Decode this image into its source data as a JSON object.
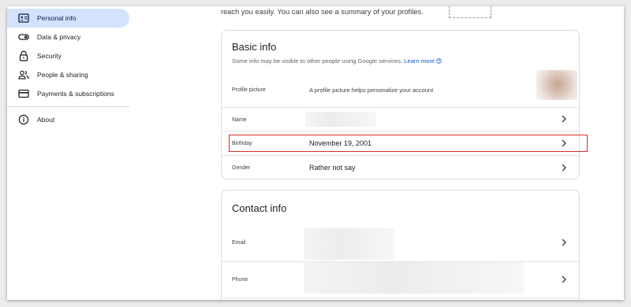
{
  "sidebar": {
    "items": [
      {
        "label": "Personal info",
        "icon": "id-card-icon",
        "active": true
      },
      {
        "label": "Data & privacy",
        "icon": "toggle-icon",
        "active": false
      },
      {
        "label": "Security",
        "icon": "lock-icon",
        "active": false
      },
      {
        "label": "People & sharing",
        "icon": "people-icon",
        "active": false
      },
      {
        "label": "Payments & subscriptions",
        "icon": "credit-card-icon",
        "active": false
      },
      {
        "label": "About",
        "icon": "info-icon",
        "active": false
      }
    ]
  },
  "main": {
    "intro_text": "reach you easily. You can also see a summary of your profiles."
  },
  "basic_info": {
    "title": "Basic info",
    "subtitle": "Some info may be visible to other people using Google services.",
    "learn_more": "Learn more",
    "rows": {
      "profile_picture": {
        "label": "Profile picture",
        "value": "A profile picture helps personalize your account"
      },
      "name": {
        "label": "Name",
        "value": ""
      },
      "birthday": {
        "label": "Birthday",
        "value": "November 19, 2001"
      },
      "gender": {
        "label": "Gender",
        "value": "Rather not say"
      }
    }
  },
  "contact_info": {
    "title": "Contact info",
    "rows": {
      "email": {
        "label": "Email",
        "value": ""
      },
      "phone": {
        "label": "Phone",
        "value": ""
      }
    }
  },
  "colors": {
    "active_nav_bg": "#d3e3fd",
    "link": "#0b57d0",
    "highlight_border": "#d93025"
  }
}
